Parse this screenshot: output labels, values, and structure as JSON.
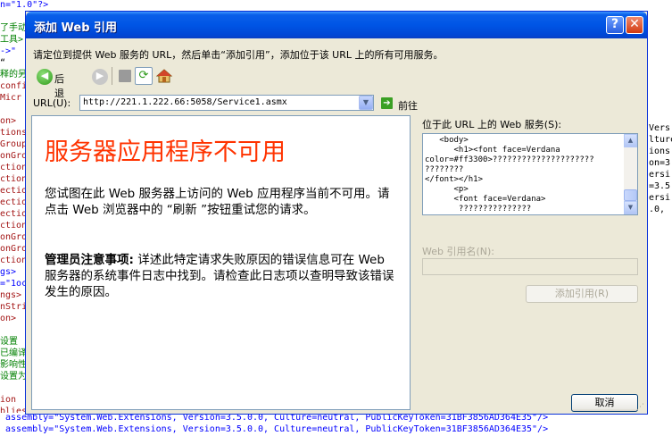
{
  "background_editor": {
    "left_lines": [
      {
        "text": "n=\"1.0\"?>",
        "color": "#0000ff"
      },
      {
        "text": "",
        "color": "#000"
      },
      {
        "text": "了手动",
        "color": "#008000"
      },
      {
        "text": "工具>",
        "color": "#008000"
      },
      {
        "text": "->\"",
        "color": "#0000ff"
      },
      {
        "text": "“",
        "color": "#000"
      },
      {
        "text": "释的另",
        "color": "#008000"
      },
      {
        "text": "confi",
        "color": "#a31515"
      },
      {
        "text": "Micr",
        "color": "#a31515"
      },
      {
        "text": "",
        "color": "#000"
      },
      {
        "text": "on>",
        "color": "#a31515"
      },
      {
        "text": "tions",
        "color": "#a31515"
      },
      {
        "text": "Group",
        "color": "#a31515"
      },
      {
        "text": "onGro",
        "color": "#a31515"
      },
      {
        "text": "ction",
        "color": "#a31515"
      },
      {
        "text": "ctionGr",
        "color": "#a31515"
      },
      {
        "text": "ection",
        "color": "#a31515"
      },
      {
        "text": "ection",
        "color": "#a31515"
      },
      {
        "text": "ection",
        "color": "#a31515"
      },
      {
        "text": "ction",
        "color": "#a31515"
      },
      {
        "text": "onGro",
        "color": "#a31515"
      },
      {
        "text": "onGrou",
        "color": "#a31515"
      },
      {
        "text": "ctionGr",
        "color": "#a31515"
      },
      {
        "text": "gs>",
        "color": "#0000ff"
      },
      {
        "text": "=\"1oc",
        "color": "#0000ff"
      },
      {
        "text": "ngs>",
        "color": "#a31515"
      },
      {
        "text": "nStri",
        "color": "#a31515"
      },
      {
        "text": "on>",
        "color": "#a31515"
      },
      {
        "text": "",
        "color": "#000"
      },
      {
        "text": "设置",
        "color": "#008000"
      },
      {
        "text": "已编译",
        "color": "#008000"
      },
      {
        "text": "影响性",
        "color": "#008000"
      },
      {
        "text": "设置为",
        "color": "#008000"
      },
      {
        "text": "",
        "color": "#000"
      },
      {
        "text": "ion",
        "color": "#a31515"
      },
      {
        "text": "blies",
        "color": "#a31515"
      }
    ],
    "right_lines": [
      {
        "text": "Vers",
        "color": "#000"
      },
      {
        "text": "lture",
        "color": "#000"
      },
      {
        "text": "ions,",
        "color": "#000"
      },
      {
        "text": "on=3",
        "color": "#000"
      },
      {
        "text": "ersi",
        "color": "#000"
      },
      {
        "text": "=3.5",
        "color": "#000"
      },
      {
        "text": "ersi",
        "color": "#000"
      },
      {
        "text": ".0,",
        "color": "#000"
      }
    ],
    "bottom_lines": [
      {
        "text": " assembly=\"System.Web.Extensions, Version=3.5.0.0, Culture=neutral, PublicKeyToken=31BF3856AD364E35\"/>",
        "color": "#0000ff"
      },
      {
        "text": " assembly=\"System.Web.Extensions, Version=3.5.0.0, Culture=neutral, PublicKeyToken=31BF3856AD364E35\"/>",
        "color": "#0000ff"
      }
    ]
  },
  "dialog": {
    "title": "添加 Web 引用",
    "help_label": "?",
    "close_label": "✕",
    "instructions": "请定位到提供 Web 服务的 URL，然后单击“添加引用”，添加位于该 URL 上的所有可用服务。",
    "toolbar": {
      "back_label": "后退",
      "back_glyph": "◀",
      "forward_glyph": "▶",
      "refresh_glyph": "⟳"
    },
    "url": {
      "label": "URL(U):",
      "value": "http://221.1.222.66:5058/Service1.asmx",
      "dropdown_glyph": "▼",
      "go_glyph": "➔",
      "go_label": "前往"
    },
    "browser": {
      "error_title": "服务器应用程序不可用",
      "error_message": "您试图在此 Web 服务器上访问的 Web 应用程序当前不可用。请点击 Web 浏览器中的 “刷新 ”按钮重试您的请求。",
      "admin_note_heading": "管理员注意事项:",
      "admin_note_body": " 详述此特定请求失败原因的错误信息可在 Web 服务器的系统事件日志中找到。请检查此日志项以查明导致该错误发生的原因。"
    },
    "services": {
      "label": "位于此 URL 上的 Web 服务(S):",
      "content": "   <body>\n      <h1><font face=Verdana\ncolor=#ff3300>?????????????????????\n????????\n</font></h1>\n      <p>\n      <font face=Verdana>\n       ???????????????",
      "scroll_up": "▲",
      "scroll_down": "▼"
    },
    "reference_name": {
      "label": "Web 引用名(N):",
      "value": ""
    },
    "add_reference_label": "添加引用(R)",
    "cancel_label": "取消",
    "grip_glyph": "⋰"
  }
}
